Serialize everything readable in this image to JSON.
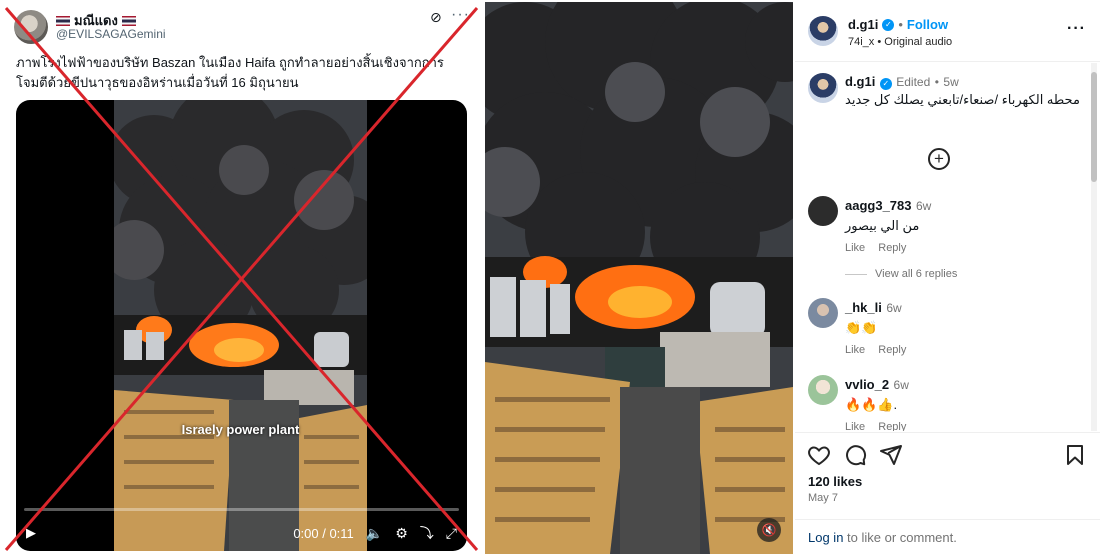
{
  "tweet": {
    "display_name": "มณีแดง",
    "handle": "@EVILSAGAGemini",
    "text": "ภาพโรงไฟฟ้าของบริษัท Baszan ในเมือง Haifa ถูกทำลายอย่างสิ้นเชิงจากการโจมตีด้วยขีปนาวุธของอิหร่านเมื่อวันที่ 16 มิถุนายน",
    "video_caption": "Israely power plant",
    "time": "0:00 / 0:11",
    "icons": [
      "play-icon",
      "volume-icon",
      "settings-icon",
      "minimize-icon",
      "fullscreen-icon",
      "grok-icon",
      "more-icon"
    ],
    "cross_color": "#d9262c"
  },
  "post": {
    "username": "d.g1i",
    "follow_label": "Follow",
    "subheading": "74i_x • Original audio",
    "caption_user": "d.g1i",
    "edited_label": "Edited",
    "caption_age": "5w",
    "caption_text": "محطه الكهرباء /صنعاء/تابعني يصلك كل جديد",
    "view_replies": "View all 6 replies",
    "comments": [
      {
        "user": "aagg3_783",
        "age": "6w",
        "text": "من الي بيصور",
        "like": "Like",
        "reply": "Reply"
      },
      {
        "user": "_hk_li",
        "age": "6w",
        "text": "👏👏",
        "like": "Like",
        "reply": "Reply"
      },
      {
        "user": "vvlio_2",
        "age": "6w",
        "text": "🔥🔥👍.",
        "like": "Like",
        "reply": "Reply"
      }
    ],
    "likes": "120 likes",
    "date": "May 7",
    "login_link": "Log in",
    "login_rest": " to like or comment.",
    "accent": "#0095f6"
  }
}
